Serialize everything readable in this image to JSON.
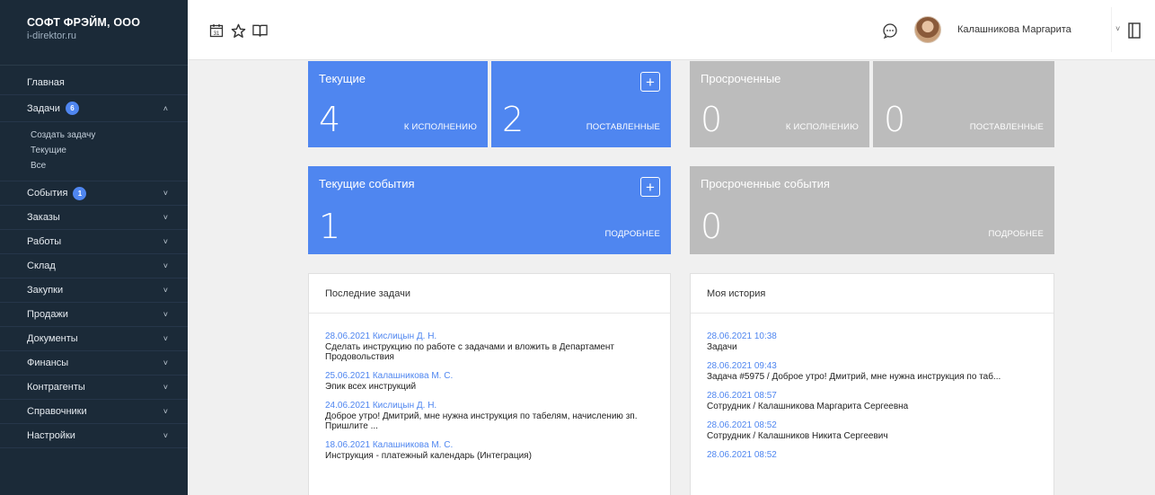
{
  "brand": {
    "name": "СОФТ ФРЭЙМ, ООО",
    "site": "i-direktor.ru"
  },
  "sidebar": {
    "home": "Главная",
    "tasks": {
      "label": "Задачи",
      "badge": "6"
    },
    "tasks_sub": [
      "Создать задачу",
      "Текущие",
      "Все"
    ],
    "events": {
      "label": "События",
      "badge": "1"
    },
    "items": [
      "Заказы",
      "Работы",
      "Склад",
      "Закупки",
      "Продажи",
      "Документы",
      "Финансы",
      "Контрагенты",
      "Справочники",
      "Настройки"
    ]
  },
  "topbar": {
    "icons": [
      "calendar-icon",
      "star-icon",
      "book-icon"
    ],
    "user_name": "Калашникова Маргарита",
    "accent": "#4f86f0"
  },
  "cards": {
    "current": {
      "title": "Текущие",
      "count1": "4",
      "caption1": "К ИСПОЛНЕНИЮ",
      "count2": "2",
      "caption2": "ПОСТАВЛЕННЫЕ"
    },
    "overdue": {
      "title": "Просроченные",
      "count1": "0",
      "caption1": "К ИСПОЛНЕНИЮ",
      "count2": "0",
      "caption2": "ПОСТАВЛЕННЫЕ"
    },
    "current_events": {
      "title": "Текущие события",
      "count": "1",
      "caption": "ПОДРОБНЕЕ"
    },
    "overdue_events": {
      "title": "Просроченные события",
      "count": "0",
      "caption": "ПОДРОБНЕЕ"
    }
  },
  "last_tasks": {
    "title": "Последние задачи",
    "items": [
      {
        "meta": "28.06.2021 Кислицын Д. Н.",
        "text": "Сделать инструкцию по работе с задачами и вложить в Департамент Продовольствия"
      },
      {
        "meta": "25.06.2021 Калашникова М. С.",
        "text": "Эпик всех инструкций"
      },
      {
        "meta": "24.06.2021 Кислицын Д. Н.",
        "text": "Доброе утро! Дмитрий, мне нужна инструкция по табелям, начислению зп. Пришлите ..."
      },
      {
        "meta": "18.06.2021 Калашникова М. С.",
        "text": "Инструкция - платежный календарь (Интеграция)"
      }
    ]
  },
  "history": {
    "title": "Моя история",
    "items": [
      {
        "meta": "28.06.2021 10:38",
        "text": "Задачи"
      },
      {
        "meta": "28.06.2021 09:43",
        "text": "Задача #5975 / Доброе утро! Дмитрий, мне нужна инструкция по таб..."
      },
      {
        "meta": "28.06.2021 08:57",
        "text": "Сотрудник / Калашникова Маргарита Сергеевна"
      },
      {
        "meta": "28.06.2021 08:52",
        "text": "Сотрудник / Калашников Никита Сергеевич"
      },
      {
        "meta": "28.06.2021 08:52",
        "text": ""
      }
    ]
  }
}
